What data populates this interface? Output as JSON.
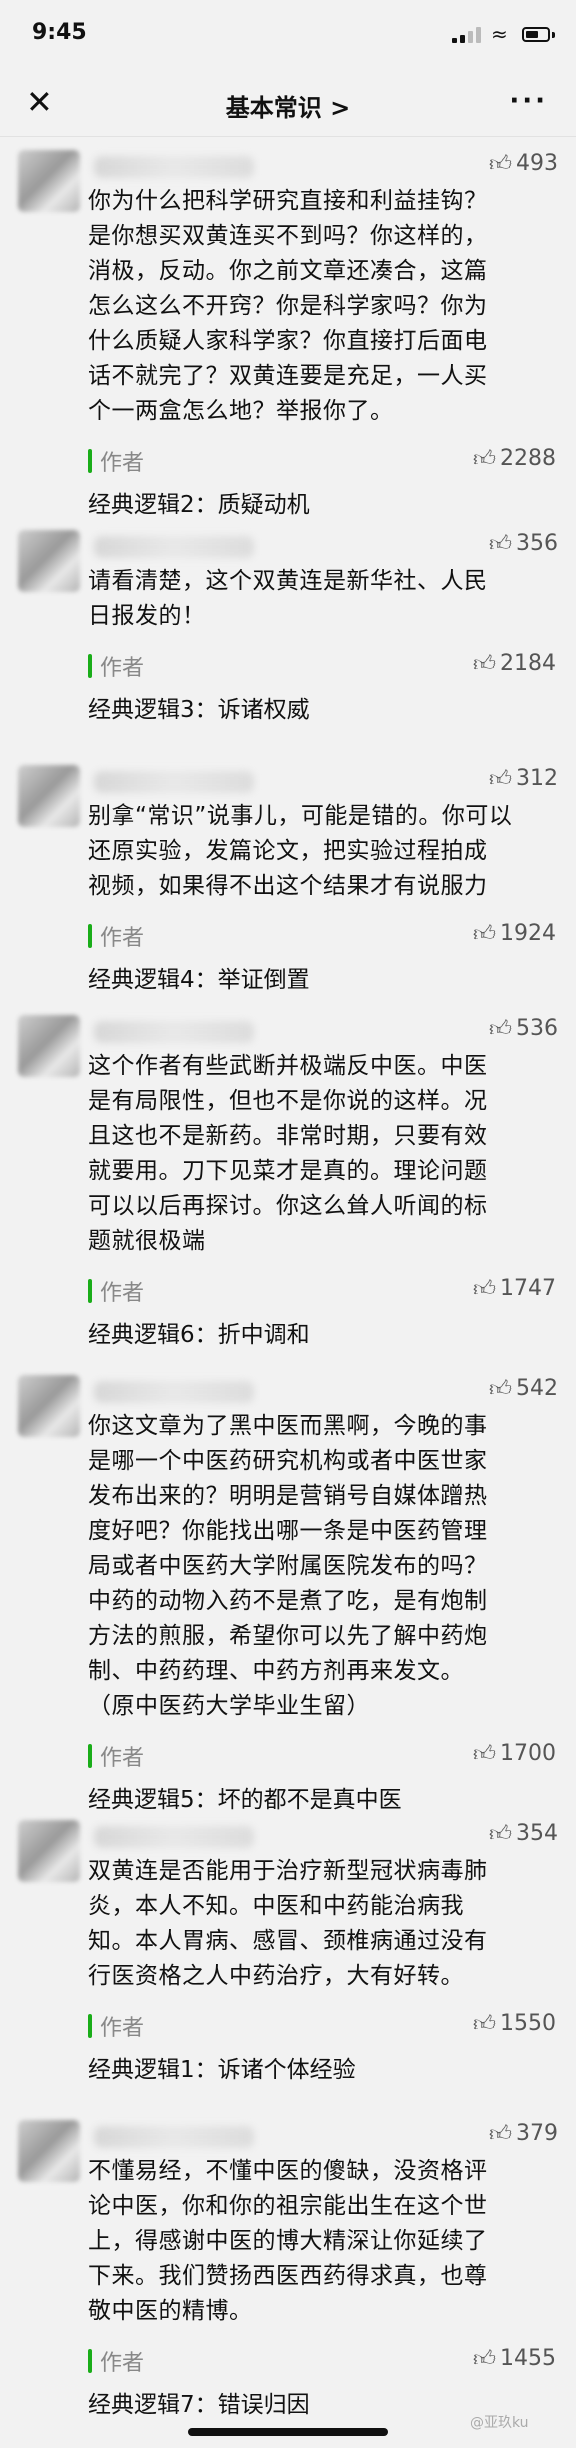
{
  "status_bar": {
    "time": "9:45"
  },
  "nav": {
    "title": "基本常识 >"
  },
  "author_label": "作者",
  "comments": [
    {
      "likes": "493",
      "lines": [
        "你为什么把科学研究直接和利益挂钩？",
        "是你想买双黄连买不到吗？你这样的，",
        "消极，反动。你之前文章还凑合，这篇",
        "怎么这么不开窍？你是科学家吗？你为",
        "什么质疑人家科学家？你直接打后面电",
        "话不就完了？双黄连要是充足，一人买",
        "个一两盒怎么地？举报你了。"
      ],
      "reply_likes": "2288",
      "reply": "经典逻辑2：质疑动机"
    },
    {
      "likes": "356",
      "lines": [
        "请看清楚，这个双黄连是新华社、人民",
        "日报发的！"
      ],
      "reply_likes": "2184",
      "reply": "经典逻辑3：诉诸权威"
    },
    {
      "likes": "312",
      "lines": [
        "别拿“常识”说事儿，可能是错的。你可以",
        "还原实验，发篇论文，把实验过程拍成",
        "视频，如果得不出这个结果才有说服力"
      ],
      "reply_likes": "1924",
      "reply": "经典逻辑4：举证倒置"
    },
    {
      "likes": "536",
      "lines": [
        "这个作者有些武断并极端反中医。中医",
        "是有局限性，但也不是你说的这样。况",
        "且这也不是新药。非常时期，只要有效",
        "就要用。刀下见菜才是真的。理论问题",
        "可以以后再探讨。你这么耸人听闻的标",
        "题就很极端"
      ],
      "reply_likes": "1747",
      "reply": "经典逻辑6：折中调和"
    },
    {
      "likes": "542",
      "lines": [
        "你这文章为了黑中医而黑啊，今晚的事",
        "是哪一个中医药研究机构或者中医世家",
        "发布出来的？明明是营销号自媒体蹭热",
        "度好吧？你能找出哪一条是中医药管理",
        "局或者中医药大学附属医院发布的吗？",
        "中药的动物入药不是煮了吃，是有炮制",
        "方法的煎服，希望你可以先了解中药炮",
        "制、中药药理、中药方剂再来发文。",
        "（原中医药大学毕业生留）"
      ],
      "reply_likes": "1700",
      "reply": "经典逻辑5：坏的都不是真中医"
    },
    {
      "likes": "354",
      "lines": [
        "双黄连是否能用于治疗新型冠状病毒肺",
        "炎，本人不知。中医和中药能治病我",
        "知。本人胃病、感冒、颈椎病通过没有",
        "行医资格之人中药治疗，大有好转。"
      ],
      "reply_likes": "1550",
      "reply": "经典逻辑1：诉诸个体经验"
    },
    {
      "likes": "379",
      "lines": [
        "不懂易经，不懂中医的傻缺，没资格评",
        "论中医，你和你的祖宗能出生在这个世",
        "上，得感谢中医的博大精深让你延续了",
        "下来。我们赞扬西医西药得求真，也尊",
        "敬中医的精博。"
      ],
      "reply_likes": "1455",
      "reply": "经典逻辑7：错误归因"
    }
  ],
  "watermark": "@亚玖ku"
}
